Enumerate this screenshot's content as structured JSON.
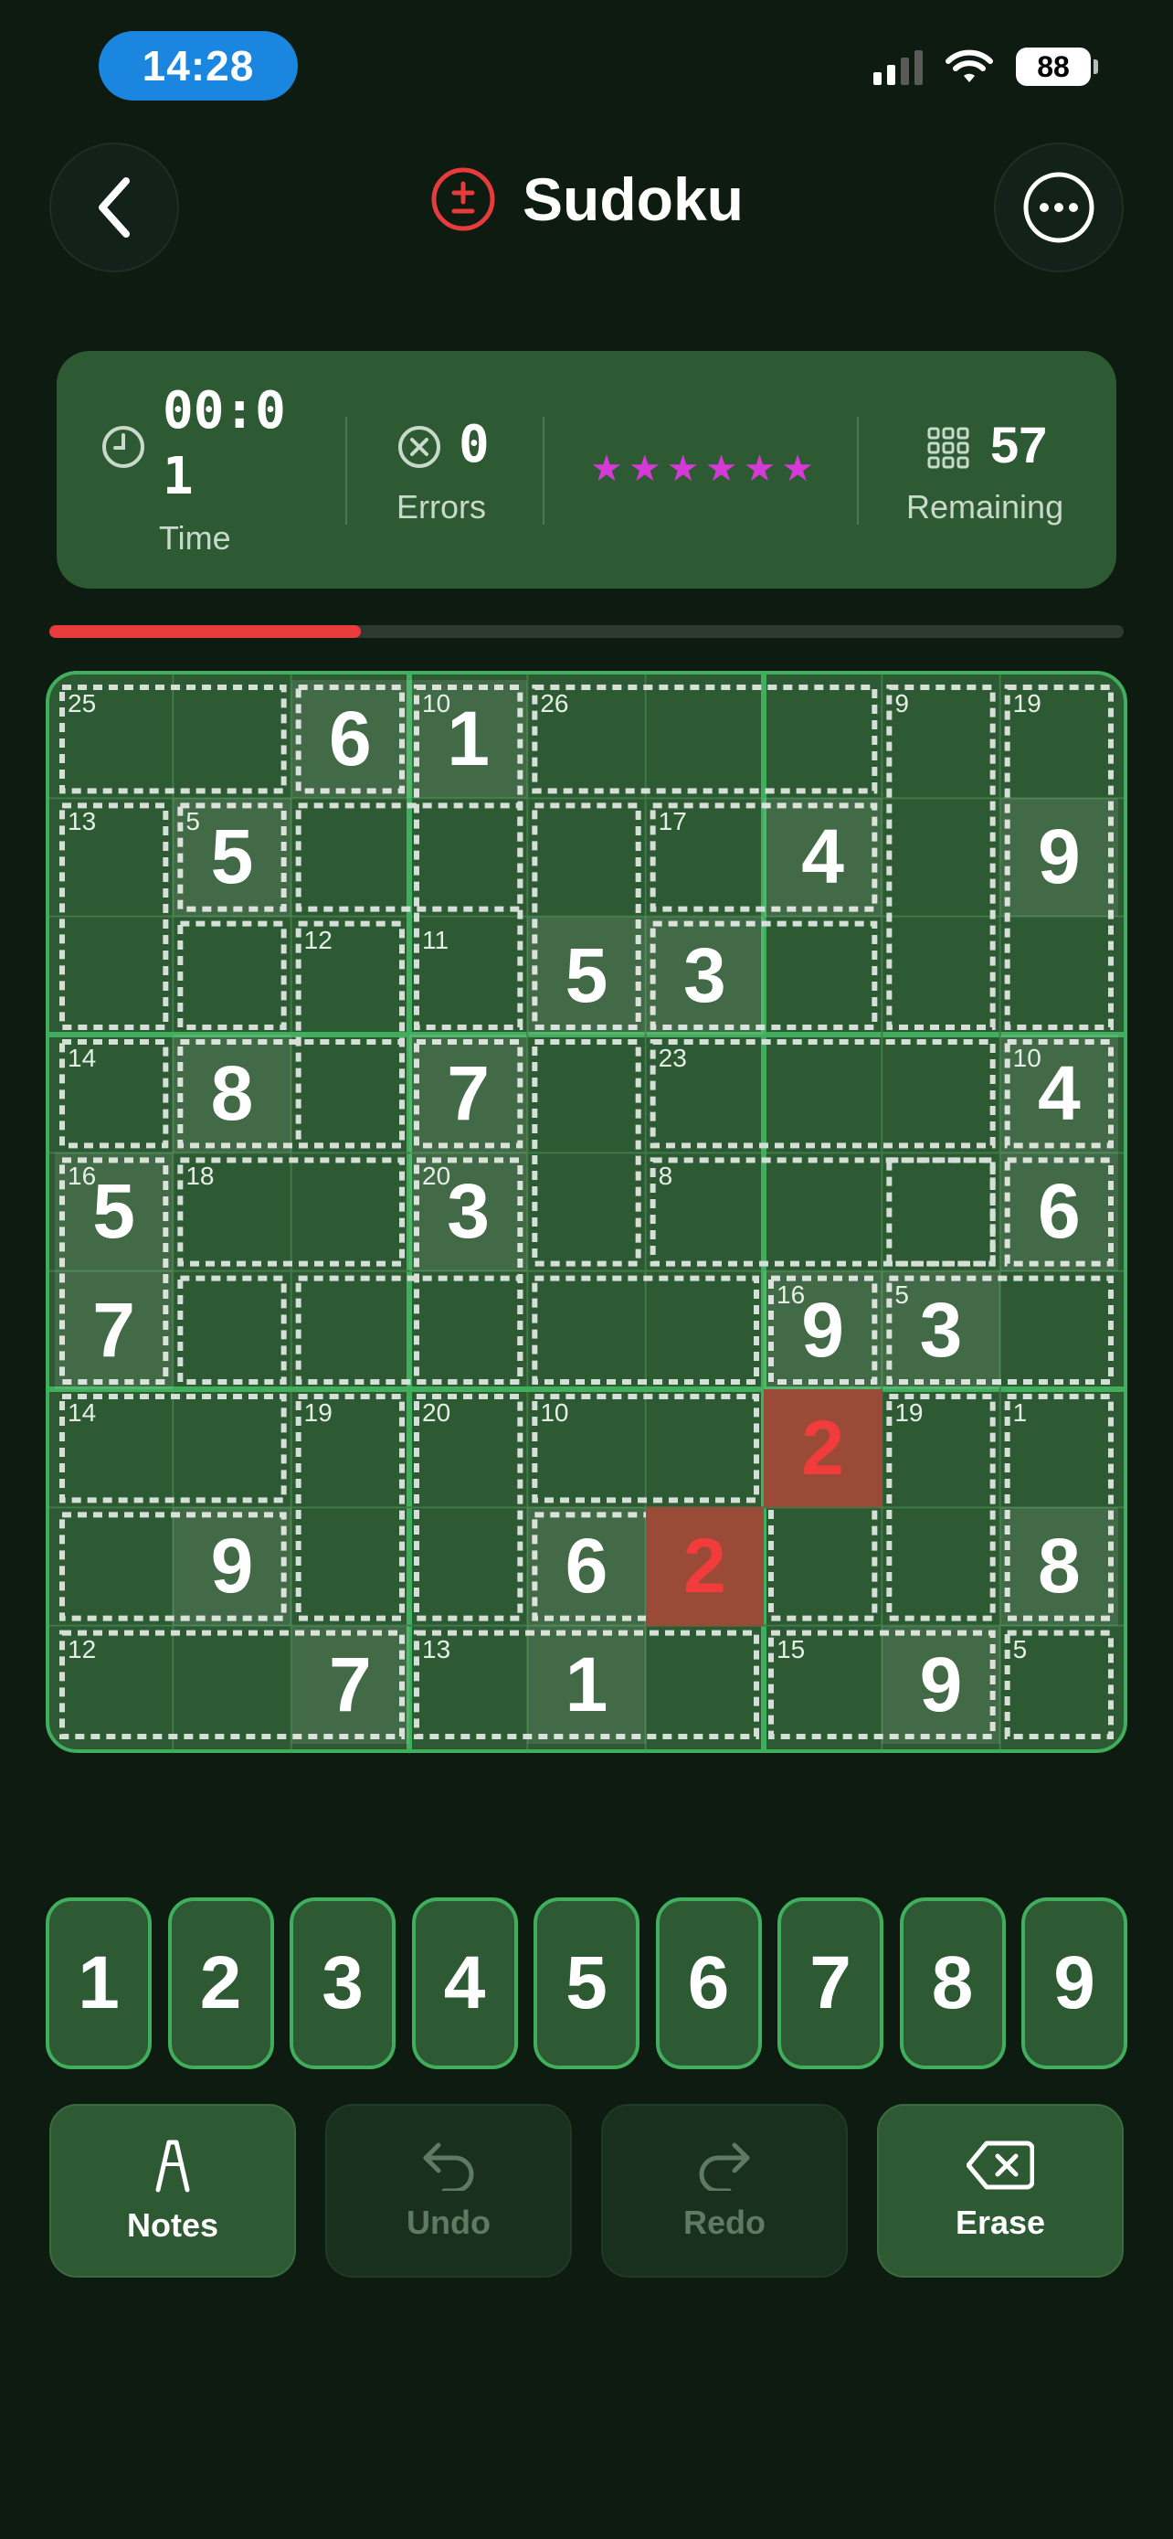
{
  "status_bar": {
    "time": "14:28",
    "battery": "88"
  },
  "header": {
    "title": "Sudoku"
  },
  "stats": {
    "time_value": "00:01",
    "time_label": "Time",
    "errors_value": "0",
    "errors_label": "Errors",
    "difficulty_stars": "★★★★★★",
    "remaining_value": "57",
    "remaining_label": "Remaining"
  },
  "progress": {
    "fraction": 0.29
  },
  "colors": {
    "accent": "#3fae5d",
    "error": "#f23b3b",
    "star": "#d63ad6",
    "progress": "#e83b3b"
  },
  "board": {
    "cells": [
      {
        "r": 0,
        "c": 2,
        "v": "6",
        "kind": "given"
      },
      {
        "r": 0,
        "c": 3,
        "v": "1",
        "kind": "given"
      },
      {
        "r": 1,
        "c": 1,
        "v": "5",
        "kind": "given"
      },
      {
        "r": 1,
        "c": 6,
        "v": "4",
        "kind": "given"
      },
      {
        "r": 1,
        "c": 8,
        "v": "9",
        "kind": "given"
      },
      {
        "r": 2,
        "c": 4,
        "v": "5",
        "kind": "given"
      },
      {
        "r": 2,
        "c": 5,
        "v": "3",
        "kind": "given"
      },
      {
        "r": 3,
        "c": 1,
        "v": "8",
        "kind": "given"
      },
      {
        "r": 3,
        "c": 3,
        "v": "7",
        "kind": "given"
      },
      {
        "r": 3,
        "c": 8,
        "v": "4",
        "kind": "given"
      },
      {
        "r": 4,
        "c": 0,
        "v": "5",
        "kind": "given"
      },
      {
        "r": 4,
        "c": 3,
        "v": "3",
        "kind": "given"
      },
      {
        "r": 4,
        "c": 8,
        "v": "6",
        "kind": "given"
      },
      {
        "r": 5,
        "c": 0,
        "v": "7",
        "kind": "given"
      },
      {
        "r": 5,
        "c": 6,
        "v": "9",
        "kind": "given"
      },
      {
        "r": 5,
        "c": 7,
        "v": "3",
        "kind": "given"
      },
      {
        "r": 6,
        "c": 6,
        "v": "2",
        "kind": "error"
      },
      {
        "r": 7,
        "c": 1,
        "v": "9",
        "kind": "given"
      },
      {
        "r": 7,
        "c": 4,
        "v": "6",
        "kind": "given"
      },
      {
        "r": 7,
        "c": 5,
        "v": "2",
        "kind": "error"
      },
      {
        "r": 7,
        "c": 8,
        "v": "8",
        "kind": "given"
      },
      {
        "r": 8,
        "c": 2,
        "v": "7",
        "kind": "given"
      },
      {
        "r": 8,
        "c": 4,
        "v": "1",
        "kind": "given"
      },
      {
        "r": 8,
        "c": 7,
        "v": "9",
        "kind": "given"
      }
    ],
    "cage_sums": [
      {
        "r": 0,
        "c": 0,
        "s": "25"
      },
      {
        "r": 0,
        "c": 3,
        "s": "10"
      },
      {
        "r": 0,
        "c": 4,
        "s": "26"
      },
      {
        "r": 0,
        "c": 7,
        "s": "9"
      },
      {
        "r": 0,
        "c": 8,
        "s": "19"
      },
      {
        "r": 1,
        "c": 0,
        "s": "13"
      },
      {
        "r": 1,
        "c": 1,
        "s": "5"
      },
      {
        "r": 1,
        "c": 5,
        "s": "17"
      },
      {
        "r": 2,
        "c": 2,
        "s": "12"
      },
      {
        "r": 2,
        "c": 3,
        "s": "11"
      },
      {
        "r": 3,
        "c": 0,
        "s": "14"
      },
      {
        "r": 3,
        "c": 5,
        "s": "23"
      },
      {
        "r": 3,
        "c": 8,
        "s": "10"
      },
      {
        "r": 4,
        "c": 0,
        "s": "16"
      },
      {
        "r": 4,
        "c": 1,
        "s": "18"
      },
      {
        "r": 4,
        "c": 3,
        "s": "20"
      },
      {
        "r": 4,
        "c": 5,
        "s": "8"
      },
      {
        "r": 5,
        "c": 6,
        "s": "16"
      },
      {
        "r": 5,
        "c": 7,
        "s": "5"
      },
      {
        "r": 6,
        "c": 0,
        "s": "14"
      },
      {
        "r": 6,
        "c": 2,
        "s": "19"
      },
      {
        "r": 6,
        "c": 3,
        "s": "20"
      },
      {
        "r": 6,
        "c": 4,
        "s": "10"
      },
      {
        "r": 6,
        "c": 7,
        "s": "19"
      },
      {
        "r": 6,
        "c": 8,
        "s": "1"
      },
      {
        "r": 8,
        "c": 0,
        "s": "12"
      },
      {
        "r": 8,
        "c": 3,
        "s": "13"
      },
      {
        "r": 8,
        "c": 6,
        "s": "15"
      },
      {
        "r": 8,
        "c": 8,
        "s": "5"
      }
    ]
  },
  "numpad": [
    "1",
    "2",
    "3",
    "4",
    "5",
    "6",
    "7",
    "8",
    "9"
  ],
  "actions": {
    "notes": "Notes",
    "undo": "Undo",
    "redo": "Redo",
    "erase": "Erase"
  }
}
